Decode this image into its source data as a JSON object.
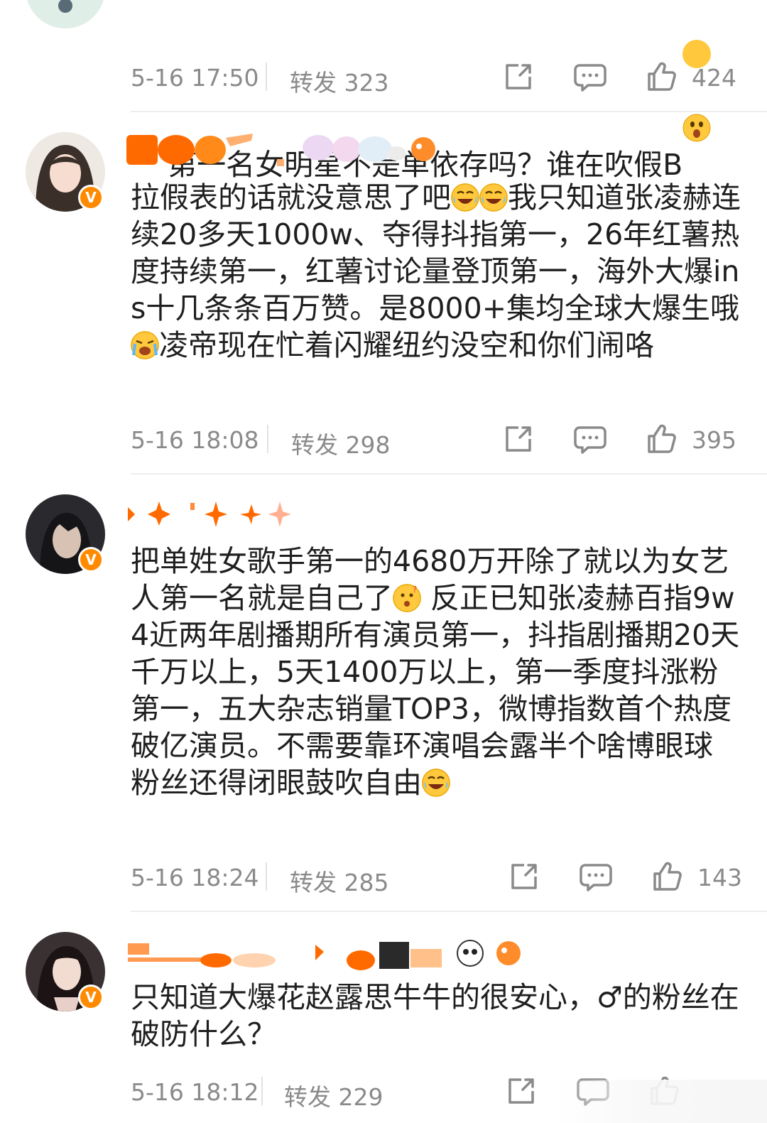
{
  "comments": [
    {
      "text": "第一名女明星不是单依存吗？谁在吹假B",
      "emoji_suffix": "surprised-emoji",
      "time": "5-16 17:50",
      "repost": "转发 323",
      "likes": "424"
    },
    {
      "text_parts": [
        "拉假表的话就没意思了吧",
        "我只知道张凌赫连续20多天1000w、夺得抖指第一，26年红薯热度持续第一，红薯讨论量登顶第一，海外大爆ins十几条条百万赞。是8000+集均全球大爆生哦",
        "凌帝现在忙着闪耀纽约没空和你们闹咯"
      ],
      "time": "5-16 18:08",
      "repost": "转发 298",
      "likes": "395"
    },
    {
      "text_parts": [
        "把单姓女歌手第一的4680万开除了就以为女艺人第一名就是自己了",
        " 反正已知张凌赫百指9w4近两年剧播期所有演员第一，抖指剧播期20天千万以上，5天1400万以上，第一季度抖涨粉第一，五大杂志销量TOP3，微博指数首个热度破亿演员。不需要靠环演唱会露半个啥博眼球 粉丝还得闭眼鼓吹自由"
      ],
      "time": "5-16 18:24",
      "repost": "转发 285",
      "likes": "143"
    },
    {
      "text": "只知道大爆花赵露思牛牛的很安心，♂的粉丝在破防什么？",
      "time": "5-16 18:12",
      "repost": "转发 229",
      "likes": ""
    }
  ],
  "icons": {
    "share": "share-icon",
    "comment": "comment-icon",
    "like": "thumbs-up-icon",
    "verified": "verified-badge-icon"
  },
  "verified_badge_letter": "V",
  "colors": {
    "accent_orange": "#ff8a00",
    "meta_gray": "#8a8a8a",
    "text": "#1f1f1f",
    "divider": "#ededed"
  }
}
